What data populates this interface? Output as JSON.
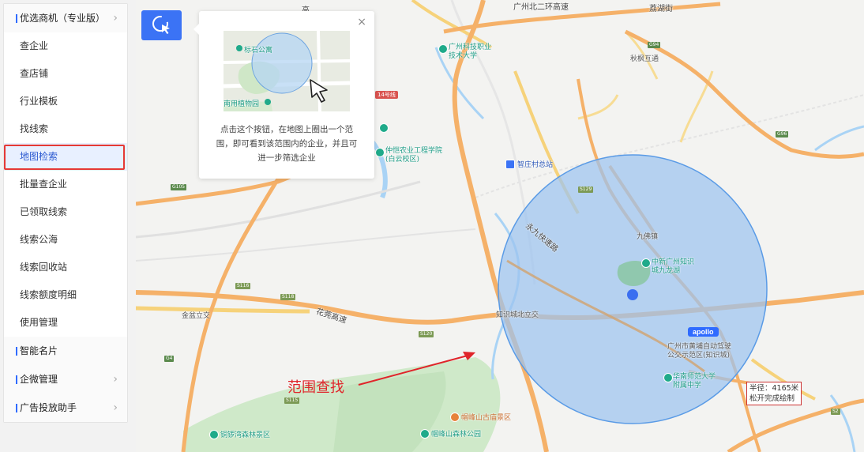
{
  "sidebar": {
    "groups": [
      {
        "label": "优选商机（专业版）",
        "expanded": true,
        "items": [
          "查企业",
          "查店铺",
          "行业模板",
          "找线索",
          "地图检索",
          "批量查企业",
          "已领取线索",
          "线索公海",
          "线索回收站",
          "线索额度明细",
          "使用管理"
        ]
      },
      {
        "label": "智能名片"
      },
      {
        "label": "企微管理"
      },
      {
        "label": "广告投放助手"
      }
    ],
    "active_item": "地图检索"
  },
  "popup": {
    "close_glyph": "×",
    "thumb_label_1": "标石公寓",
    "thumb_label_2": "南用植物园",
    "description": "点击这个按钮，在地图上圈出一个范围，即可看到该范围内的企业，并且可进一步筛选企业"
  },
  "annotation": {
    "text": "范围查找",
    "color": "#e0242a"
  },
  "radius_box": {
    "line1": "半径：4165米",
    "line2": "松开完成绘制"
  },
  "map": {
    "labels": {
      "gz_tech": "广州科技职业\n技术大学",
      "zhongkai": "仲恺农业工程学院\n(白云校区)",
      "zhuangcun": "智庄村总站",
      "liufeng": "秋枫互通",
      "jiulong": "九佛镇",
      "zhongxin": "中新广州知识\n城九龙湖",
      "zhishicheng": "知识城北立交",
      "jinpen": "金盆立交",
      "huaguan": "花莞高速",
      "yongjiu": "永九快速路",
      "huangpu": "广州市黄埔自动驾驶\n公交示范区(知识城)",
      "huanan": "华南师范大学\n附属中学",
      "maofeng_temple": "帽峰山古庙景区",
      "maofeng_park": "帽峰山森林公园",
      "tongluowan": "铜锣湾森林景区",
      "top_road": "广州北二环高速",
      "top_right": "荔湖街",
      "top_mid": "高",
      "metro": "14号线"
    },
    "shields": {
      "g105": "G105",
      "s118": "S118",
      "s116": "S116",
      "g4": "G4",
      "s115": "S115",
      "g94": "G94",
      "s96": "G96",
      "s120": "S120",
      "s2": "S2",
      "s129": "S129"
    },
    "apollo": "apollo"
  },
  "colors": {
    "accent": "#3b73f5",
    "circle_fill": "#9cc3f0",
    "circle_stroke": "#5a9be6",
    "highlight": "#e53935"
  }
}
